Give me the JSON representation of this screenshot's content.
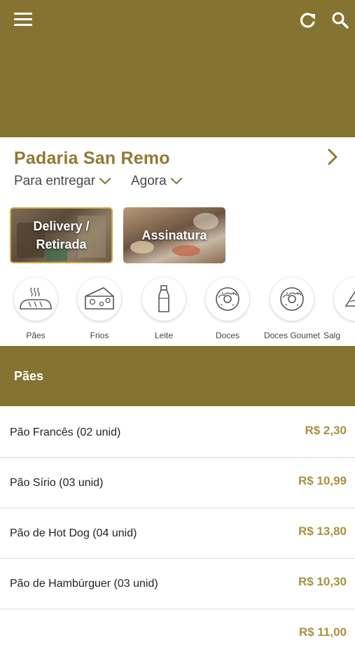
{
  "header": {
    "menu_icon": "menu-icon",
    "refresh_icon": "refresh-icon",
    "search_icon": "search-icon",
    "color": "#857332"
  },
  "store": {
    "name": "Padaria San Remo",
    "accent": "#8e7a33"
  },
  "options": {
    "delivery_mode": "Para entregar",
    "time": "Agora"
  },
  "cards": [
    {
      "label_line1": "Delivery /",
      "label_line2": "Retirada"
    },
    {
      "label": "Assinatura"
    }
  ],
  "categories": [
    {
      "label": "Pães",
      "icon": "bread-icon"
    },
    {
      "label": "Frios",
      "icon": "cheese-icon"
    },
    {
      "label": "Leite",
      "icon": "milk-bottle-icon"
    },
    {
      "label": "Doces",
      "icon": "donut-icon"
    },
    {
      "label": "Doces Goumet",
      "icon": "donut-icon"
    },
    {
      "label": "Salg",
      "icon": "savory-icon"
    }
  ],
  "section": {
    "title": "Pães"
  },
  "products": [
    {
      "name": "Pão Francês (02 unid)",
      "price": "R$ 2,30"
    },
    {
      "name": "Pão Sírio (03 unid)",
      "price": "R$ 10,99"
    },
    {
      "name": "Pão de Hot Dog (04 unid)",
      "price": "R$ 13,80"
    },
    {
      "name": "Pão de Hambúrguer (03 unid)",
      "price": "R$ 10,30"
    },
    {
      "name": "",
      "price": "R$ 11,00"
    }
  ]
}
